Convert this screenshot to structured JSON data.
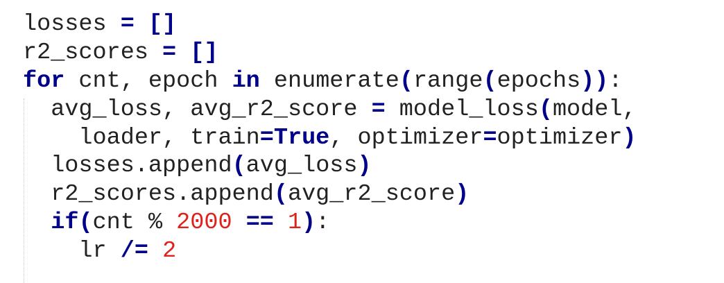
{
  "colors": {
    "keyword": "#00008b",
    "operator": "#00008b",
    "number": "#e0201a",
    "text": "#222222",
    "background": "#ffffff"
  },
  "code_lines": [
    [
      {
        "t": "txt",
        "v": "losses "
      },
      {
        "t": "op",
        "v": "="
      },
      {
        "t": "txt",
        "v": " "
      },
      {
        "t": "op",
        "v": "[]"
      }
    ],
    [
      {
        "t": "txt",
        "v": "r2_scores "
      },
      {
        "t": "op",
        "v": "="
      },
      {
        "t": "txt",
        "v": " "
      },
      {
        "t": "op",
        "v": "[]"
      }
    ],
    [
      {
        "t": "kw",
        "v": "for"
      },
      {
        "t": "txt",
        "v": " cnt, epoch "
      },
      {
        "t": "kw",
        "v": "in"
      },
      {
        "t": "txt",
        "v": " enumerate"
      },
      {
        "t": "op",
        "v": "("
      },
      {
        "t": "txt",
        "v": "range"
      },
      {
        "t": "op",
        "v": "("
      },
      {
        "t": "txt",
        "v": "epochs"
      },
      {
        "t": "op",
        "v": "))"
      },
      {
        "t": "txt",
        "v": ":"
      }
    ],
    [
      {
        "t": "txt",
        "v": "  avg_loss, avg_r2_score "
      },
      {
        "t": "op",
        "v": "="
      },
      {
        "t": "txt",
        "v": " model_loss"
      },
      {
        "t": "op",
        "v": "("
      },
      {
        "t": "txt",
        "v": "model,"
      }
    ],
    [
      {
        "t": "txt",
        "v": "    loader, train"
      },
      {
        "t": "op",
        "v": "="
      },
      {
        "t": "kw",
        "v": "True"
      },
      {
        "t": "txt",
        "v": ", optimizer"
      },
      {
        "t": "op",
        "v": "="
      },
      {
        "t": "txt",
        "v": "optimizer"
      },
      {
        "t": "op",
        "v": ")"
      }
    ],
    [
      {
        "t": "txt",
        "v": "  losses.append"
      },
      {
        "t": "op",
        "v": "("
      },
      {
        "t": "txt",
        "v": "avg_loss"
      },
      {
        "t": "op",
        "v": ")"
      }
    ],
    [
      {
        "t": "txt",
        "v": "  r2_scores.append"
      },
      {
        "t": "op",
        "v": "("
      },
      {
        "t": "txt",
        "v": "avg_r2_score"
      },
      {
        "t": "op",
        "v": ")"
      }
    ],
    [
      {
        "t": "txt",
        "v": "  "
      },
      {
        "t": "kw",
        "v": "if"
      },
      {
        "t": "op",
        "v": "("
      },
      {
        "t": "txt",
        "v": "cnt % "
      },
      {
        "t": "num",
        "v": "2000"
      },
      {
        "t": "txt",
        "v": " "
      },
      {
        "t": "op",
        "v": "=="
      },
      {
        "t": "txt",
        "v": " "
      },
      {
        "t": "num",
        "v": "1"
      },
      {
        "t": "op",
        "v": ")"
      },
      {
        "t": "txt",
        "v": ":"
      }
    ],
    [
      {
        "t": "txt",
        "v": "    lr "
      },
      {
        "t": "op",
        "v": "/="
      },
      {
        "t": "txt",
        "v": " "
      },
      {
        "t": "num",
        "v": "2"
      }
    ]
  ]
}
